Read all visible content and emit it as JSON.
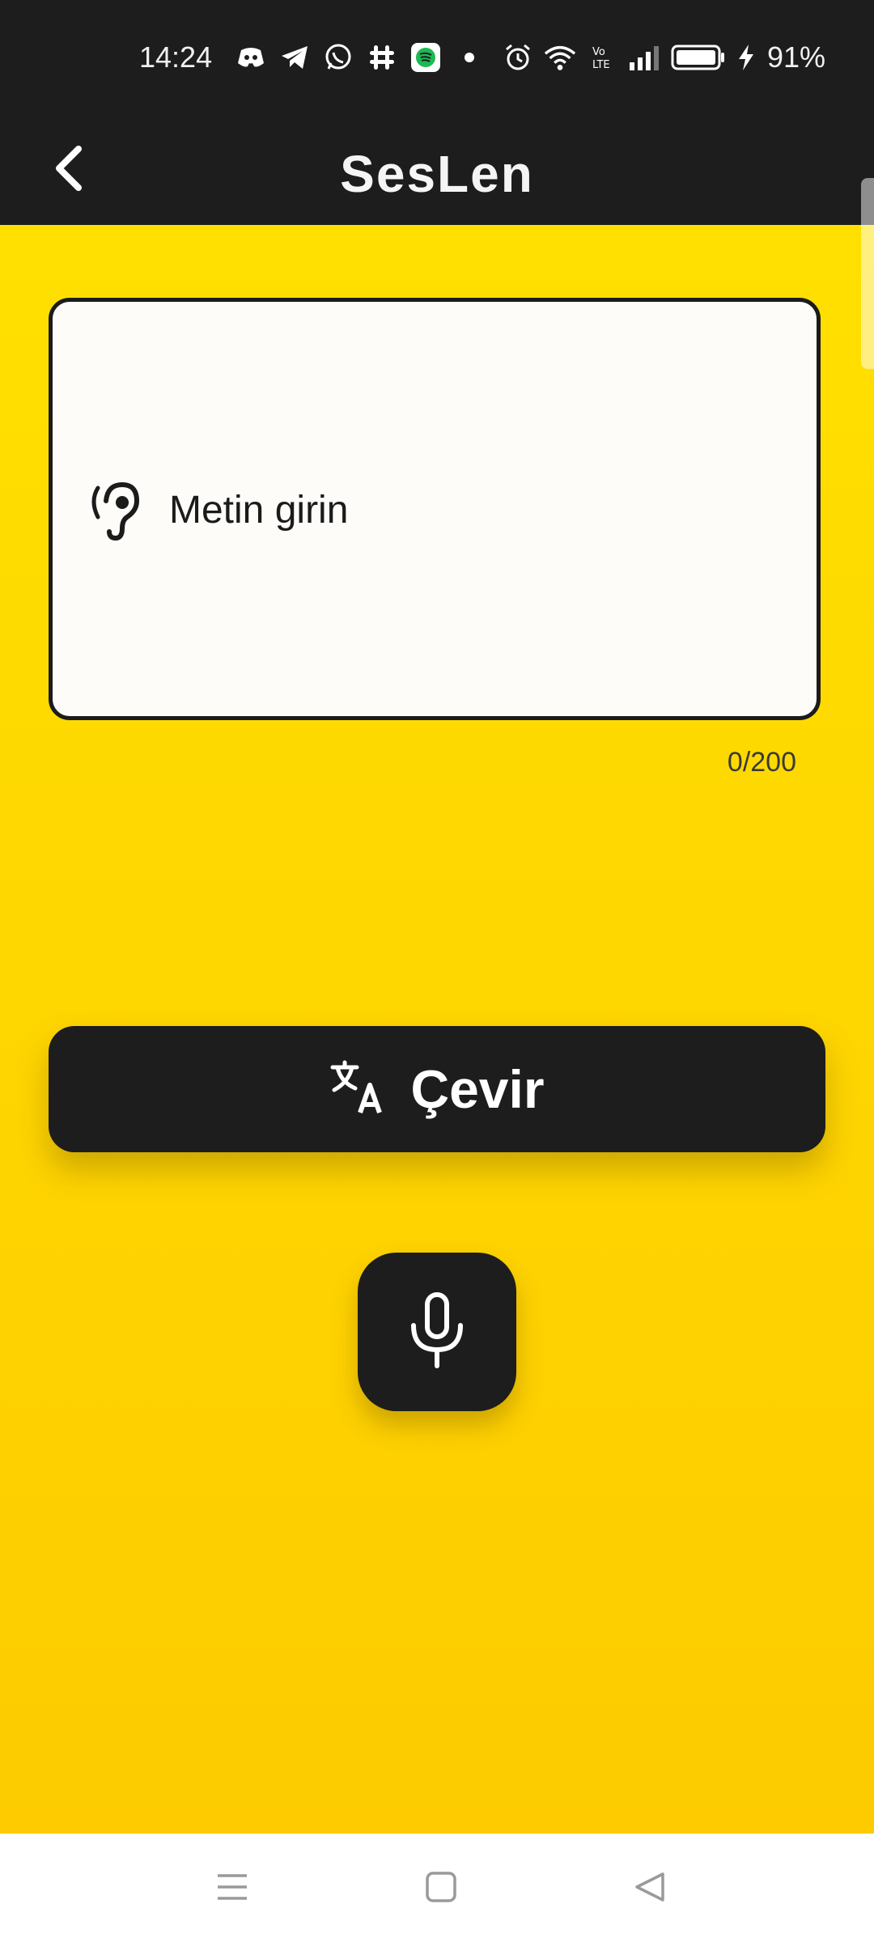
{
  "status_bar": {
    "time": "14:24",
    "battery_percent": "91%",
    "notification_icons": [
      "discord-icon",
      "telegram-icon",
      "whatsapp-icon",
      "slack-icon",
      "spotify-icon",
      "dot-icon"
    ],
    "system_icons": [
      "alarm-icon",
      "wifi-icon",
      "volte-icon",
      "signal-icon",
      "battery-icon",
      "charging-icon"
    ]
  },
  "app_bar": {
    "title": "SesLen",
    "back_icon": "chevron-left-icon"
  },
  "input": {
    "placeholder": "Metin girin",
    "value": "",
    "counter": "0/200",
    "leading_icon": "ear-icon"
  },
  "translate_button": {
    "label": "Çevir",
    "icon": "translate-icon"
  },
  "mic_button": {
    "icon": "microphone-icon"
  },
  "nav_bar": {
    "buttons": [
      "menu-icon",
      "home-icon",
      "back-icon"
    ]
  },
  "colors": {
    "background_top": "#ffe000",
    "background_bottom": "#fdcb00",
    "dark": "#1d1d1d",
    "input_bg": "#fdfcf9"
  }
}
